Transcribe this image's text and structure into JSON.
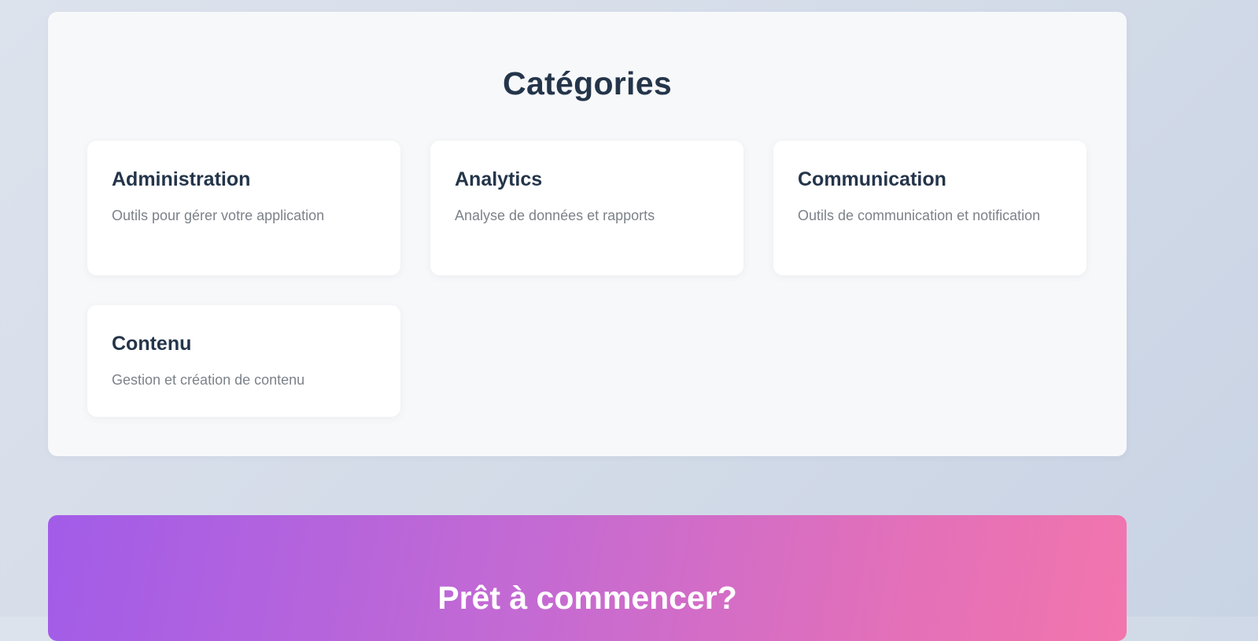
{
  "categories": {
    "title": "Catégories",
    "items": [
      {
        "title": "Administration",
        "description": "Outils pour gérer votre application"
      },
      {
        "title": "Analytics",
        "description": "Analyse de données et rapports"
      },
      {
        "title": "Communication",
        "description": "Outils de communication et notification"
      },
      {
        "title": "Contenu",
        "description": "Gestion et création de contenu"
      }
    ]
  },
  "cta": {
    "title": "Prêt à commencer?"
  },
  "colors": {
    "heading": "#24354a",
    "description": "#7c828a",
    "cta_gradient_start": "#a25ce8",
    "cta_gradient_end": "#f275ad"
  }
}
